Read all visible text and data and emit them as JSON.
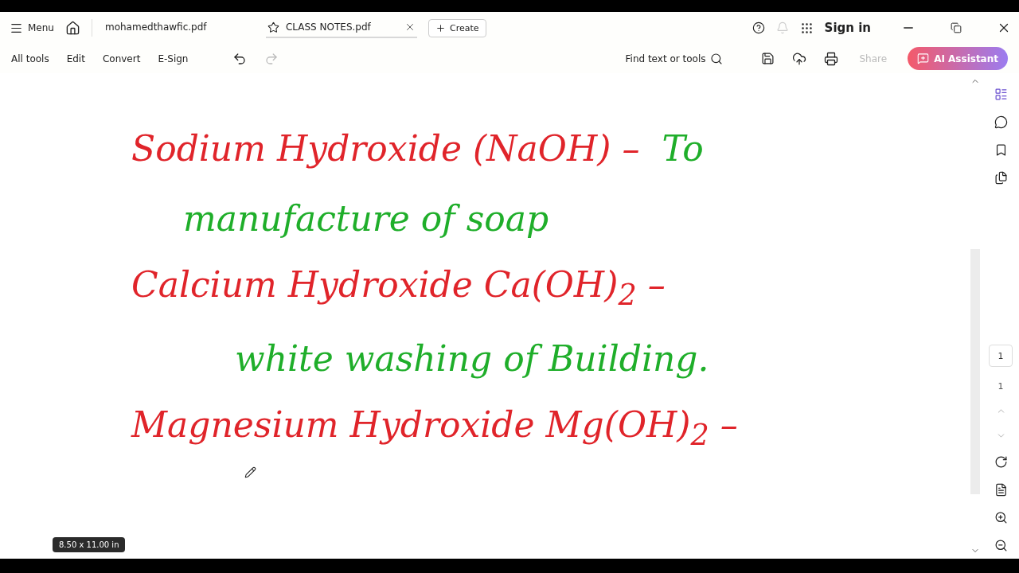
{
  "title_bar": {
    "menu_label": "Menu",
    "tabs": [
      {
        "label": "mohamedthawfic.pdf",
        "selected": false
      },
      {
        "label": "CLASS NOTES.pdf",
        "selected": true
      }
    ],
    "create_label": "Create",
    "sign_in": "Sign in"
  },
  "toolbar": {
    "items": [
      "All tools",
      "Edit",
      "Convert",
      "E-Sign"
    ],
    "search": "Find text or tools",
    "share": {
      "label": "Share",
      "disabled": true
    },
    "ai_button": "AI Assistant"
  },
  "document": {
    "lines": [
      {
        "kind": "name",
        "segments": [
          {
            "text": "Sodium Hydroxide (NaOH) –",
            "color": "#e0242a"
          },
          {
            "text": "To",
            "color": "#1fae2a"
          }
        ]
      },
      {
        "kind": "use",
        "segments": [
          {
            "text": "manufacture of soap",
            "color": "#1fae2a"
          }
        ]
      },
      {
        "kind": "name",
        "segments": [
          {
            "text": "Calcium Hydroxide Ca(OH)$_{2}$ –",
            "color": "#e0242a"
          }
        ]
      },
      {
        "kind": "use2",
        "segments": [
          {
            "text": "white washing of Building.",
            "color": "#1fae2a"
          }
        ]
      },
      {
        "kind": "name",
        "segments": [
          {
            "text": "Magnesium Hydroxide Mg(OH)$_{2}$ –",
            "color": "#e0242a"
          }
        ]
      }
    ],
    "page_size": "8.50 x 11.00 in"
  },
  "page_nav": {
    "current": "1",
    "total": "1"
  }
}
